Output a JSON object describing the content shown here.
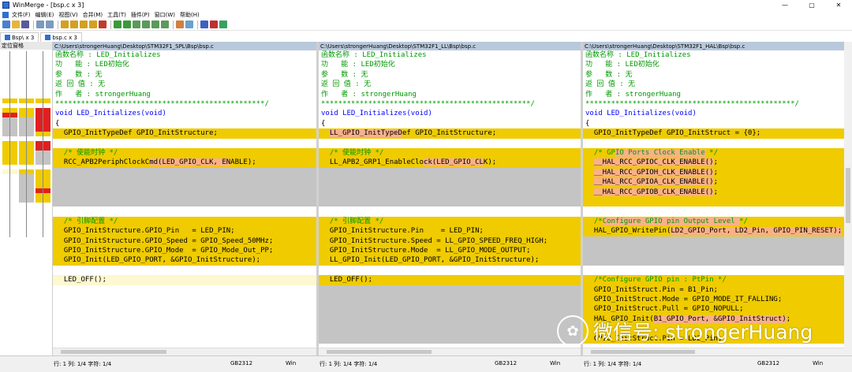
{
  "window": {
    "title": "WinMerge - [bsp.c x 3]",
    "controls": [
      "—",
      "▢",
      "✕"
    ]
  },
  "menu": [
    "文件(F)",
    "编辑(E)",
    "视图(V)",
    "合并(M)",
    "工具(T)",
    "插件(P)",
    "窗口(W)",
    "帮助(H)"
  ],
  "tabs": [
    {
      "label": "Bsp\\ x 3"
    },
    {
      "label": "bsp.c x 3"
    }
  ],
  "location_pane": {
    "title": "定位窗格"
  },
  "colors": {
    "diff": "#efcb00",
    "diff_word": "#fbb087",
    "missing": "#c4c4c4",
    "moved_light": "#fdf8cf",
    "header": "#b9c9dc",
    "comment": "#009900",
    "keyword": "#0000ff"
  },
  "panes": [
    {
      "path": "C:\\Users\\strongerHuang\\Desktop\\STM32F1_SPL\\Bsp\\bsp.c",
      "lines": [
        {
          "t": "函数名称 : LED_Initializes",
          "c": "comment"
        },
        {
          "t": "功   能 : LED初始化",
          "c": "comment"
        },
        {
          "t": "参   数 : 无",
          "c": "comment"
        },
        {
          "t": "返 回 值 : 无",
          "c": "comment"
        },
        {
          "t": "作   者 : strongerHuang",
          "c": "comment"
        },
        {
          "t": "*************************************************/",
          "c": "comment"
        },
        {
          "t": "void LED_Initializes(void)",
          "c": "kw"
        },
        {
          "t": "{",
          "c": "plain"
        },
        {
          "t": "  GPIO_InitTypeDef GPIO_InitStructure;",
          "c": "plain",
          "bg": "diff"
        },
        {
          "t": "",
          "bg": "white"
        },
        {
          "t": "  /* 使能时钟 */",
          "c": "comment",
          "bg": "diff"
        },
        {
          "t": "  RCC_APB2PeriphClockCmd(LED_GPIO_CLK, ENABLE);",
          "c": "plain",
          "bg": "diff",
          "hl": [
            22,
            41
          ]
        },
        {
          "t": "",
          "bg": "missing"
        },
        {
          "t": "",
          "bg": "missing"
        },
        {
          "t": "",
          "bg": "missing"
        },
        {
          "t": "",
          "bg": "missing"
        },
        {
          "t": "",
          "bg": "white"
        },
        {
          "t": "  /* 引脚配置 */",
          "c": "comment",
          "bg": "diff"
        },
        {
          "t": "  GPIO_InitStructure.GPIO_Pin   = LED_PIN;",
          "c": "plain",
          "bg": "diff"
        },
        {
          "t": "  GPIO_InitStructure.GPIO_Speed = GPIO_Speed_50MHz;",
          "c": "plain",
          "bg": "diff"
        },
        {
          "t": "  GPIO_InitStructure.GPIO_Mode  = GPIO_Mode_Out_PP;",
          "c": "plain",
          "bg": "diff"
        },
        {
          "t": "  GPIO_Init(LED_GPIO_PORT, &GPIO_InitStructure);",
          "c": "plain",
          "bg": "diff"
        },
        {
          "t": "",
          "bg": "white"
        },
        {
          "t": "  LED_OFF();",
          "c": "plain",
          "bg": "moved_light"
        },
        {
          "t": "",
          "bg": "white"
        },
        {
          "t": "",
          "bg": "white"
        },
        {
          "t": "",
          "bg": "white"
        },
        {
          "t": "",
          "bg": "white"
        },
        {
          "t": "",
          "bg": "white"
        },
        {
          "t": "",
          "bg": "white"
        }
      ]
    },
    {
      "path": "C:\\Users\\strongerHuang\\Desktop\\STM32F1_LL\\Bsp\\bsp.c",
      "lines": [
        {
          "t": "函数名称 : LED_Initializes",
          "c": "comment"
        },
        {
          "t": "功   能 : LED初始化",
          "c": "comment"
        },
        {
          "t": "参   数 : 无",
          "c": "comment"
        },
        {
          "t": "返 回 值 : 无",
          "c": "comment"
        },
        {
          "t": "作   者 : strongerHuang",
          "c": "comment"
        },
        {
          "t": "*************************************************/",
          "c": "comment"
        },
        {
          "t": "void LED_Initializes(void)",
          "c": "kw"
        },
        {
          "t": "{",
          "c": "plain"
        },
        {
          "t": "  LL_GPIO_InitTypeDef GPIO_InitStructure;",
          "c": "plain",
          "bg": "diff",
          "hl": [
            2,
            19
          ]
        },
        {
          "t": "",
          "bg": "white"
        },
        {
          "t": "  /* 使能时钟 */",
          "c": "comment",
          "bg": "diff"
        },
        {
          "t": "  LL_APB2_GRP1_EnableClock(LED_GPIO_CLK);",
          "c": "plain",
          "bg": "diff",
          "hl": [
            24,
            38
          ]
        },
        {
          "t": "",
          "bg": "missing"
        },
        {
          "t": "",
          "bg": "missing"
        },
        {
          "t": "",
          "bg": "missing"
        },
        {
          "t": "",
          "bg": "missing"
        },
        {
          "t": "",
          "bg": "white"
        },
        {
          "t": "  /* 引脚配置 */",
          "c": "comment",
          "bg": "diff"
        },
        {
          "t": "  GPIO_InitStructure.Pin    = LED_PIN;",
          "c": "plain",
          "bg": "diff"
        },
        {
          "t": "  GPIO_InitStructure.Speed = LL_GPIO_SPEED_FREQ_HIGH;",
          "c": "plain",
          "bg": "diff"
        },
        {
          "t": "  GPIO_InitStructure.Mode  = LL_GPIO_MODE_OUTPUT;",
          "c": "plain",
          "bg": "diff"
        },
        {
          "t": "  LL_GPIO_Init(LED_GPIO_PORT, &GPIO_InitStructure);",
          "c": "plain",
          "bg": "diff"
        },
        {
          "t": "",
          "bg": "white"
        },
        {
          "t": "  LED_OFF();",
          "c": "plain",
          "bg": "diff"
        },
        {
          "t": "",
          "bg": "missing"
        },
        {
          "t": "",
          "bg": "missing"
        },
        {
          "t": "",
          "bg": "missing"
        },
        {
          "t": "",
          "bg": "missing"
        },
        {
          "t": "",
          "bg": "missing"
        },
        {
          "t": "",
          "bg": "missing"
        }
      ]
    },
    {
      "path": "C:\\Users\\strongerHuang\\Desktop\\STM32F1_HAL\\Bsp\\bsp.c",
      "lines": [
        {
          "t": "函数名称 : LED_Initializes",
          "c": "comment"
        },
        {
          "t": "功   能 : LED初始化",
          "c": "comment"
        },
        {
          "t": "参   数 : 无",
          "c": "comment"
        },
        {
          "t": "返 回 值 : 无",
          "c": "comment"
        },
        {
          "t": "作   者 : strongerHuang",
          "c": "comment"
        },
        {
          "t": "*************************************************/",
          "c": "comment"
        },
        {
          "t": "void LED_Initializes(void)",
          "c": "kw"
        },
        {
          "t": "{",
          "c": "plain"
        },
        {
          "t": "  GPIO_InitTypeDef GPIO_InitStruct = {0};",
          "c": "plain",
          "bg": "diff"
        },
        {
          "t": "",
          "bg": "white"
        },
        {
          "t": "  /* GPIO Ports Clock Enable */",
          "c": "comment",
          "bg": "diff",
          "hl": [
            7,
            28
          ]
        },
        {
          "t": "  __HAL_RCC_GPIOC_CLK_ENABLE();",
          "c": "plain",
          "bg": "diff",
          "hl": [
            2,
            30
          ]
        },
        {
          "t": "  __HAL_RCC_GPIOH_CLK_ENABLE();",
          "c": "plain",
          "bg": "diff",
          "hl": [
            2,
            30
          ]
        },
        {
          "t": "  __HAL_RCC_GPIOA_CLK_ENABLE();",
          "c": "plain",
          "bg": "diff",
          "hl": [
            2,
            30
          ]
        },
        {
          "t": "  __HAL_RCC_GPIOB_CLK_ENABLE();",
          "c": "plain",
          "bg": "diff",
          "hl": [
            2,
            30
          ]
        },
        {
          "t": "",
          "bg": "diff"
        },
        {
          "t": "",
          "bg": "white"
        },
        {
          "t": "  /*Configure GPIO pin Output Level */",
          "c": "comment",
          "bg": "diff",
          "hl": [
            4,
            36
          ]
        },
        {
          "t": "  HAL_GPIO_WritePin(LD2_GPIO_Port, LD2_Pin, GPIO_PIN_RESET);",
          "c": "plain",
          "bg": "diff",
          "hl": [
            20,
            60
          ]
        },
        {
          "t": "",
          "bg": "missing"
        },
        {
          "t": "",
          "bg": "missing"
        },
        {
          "t": "",
          "bg": "missing"
        },
        {
          "t": "",
          "bg": "white"
        },
        {
          "t": "  /*Configure GPIO pin : PtPin */",
          "c": "comment",
          "bg": "diff"
        },
        {
          "t": "  GPIO_InitStruct.Pin = B1_Pin;",
          "c": "plain",
          "bg": "diff"
        },
        {
          "t": "  GPIO_InitStruct.Mode = GPIO_MODE_IT_FALLING;",
          "c": "plain",
          "bg": "diff"
        },
        {
          "t": "  GPIO_InitStruct.Pull = GPIO_NOPULL;",
          "c": "plain",
          "bg": "diff"
        },
        {
          "t": "  HAL_GPIO_Init(B1_GPIO_Port, &GPIO_InitStruct);",
          "c": "plain",
          "bg": "diff",
          "hl": [
            16,
            47
          ]
        },
        {
          "t": "",
          "bg": "diff"
        },
        {
          "t": "  GPIO_InitStruct.Pin = LD2_Pin;",
          "c": "plain",
          "bg": "diff"
        }
      ]
    }
  ],
  "status": [
    {
      "pos": "行: 1  列: 1/4  字符: 1/4",
      "enc": "GB2312",
      "eol": "Win"
    },
    {
      "pos": "行: 1  列: 1/4  字符: 1/4",
      "enc": "GB2312",
      "eol": "Win"
    },
    {
      "pos": "行: 1  列: 1/4  字符: 1/4",
      "enc": "GB2312",
      "eol": "Win"
    }
  ],
  "watermark": {
    "text": "微信号: strongerHuang"
  }
}
